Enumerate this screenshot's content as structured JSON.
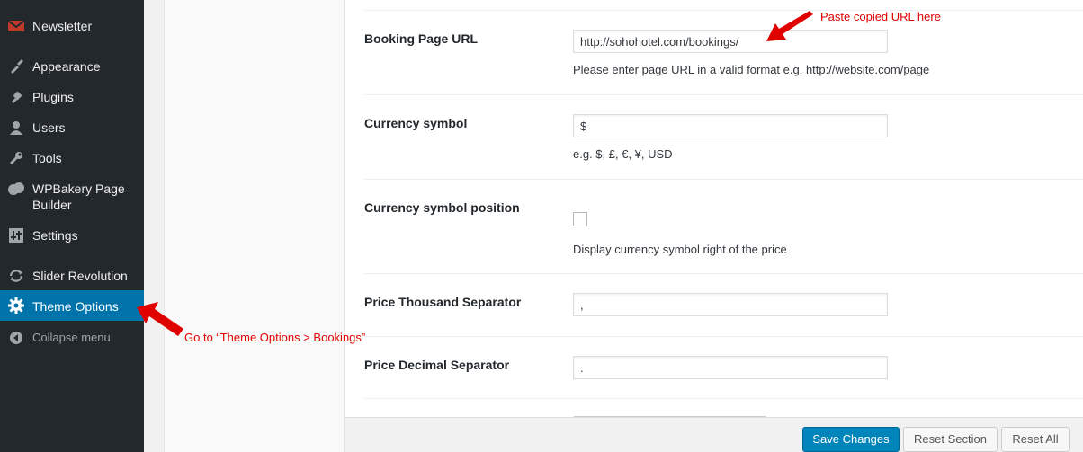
{
  "sidebar": {
    "items": [
      {
        "id": "newsletter",
        "label": "Newsletter",
        "icon": "envelope-icon"
      },
      {
        "id": "appearance",
        "label": "Appearance",
        "icon": "paintbrush-icon"
      },
      {
        "id": "plugins",
        "label": "Plugins",
        "icon": "plug-icon"
      },
      {
        "id": "users",
        "label": "Users",
        "icon": "user-icon"
      },
      {
        "id": "tools",
        "label": "Tools",
        "icon": "wrench-icon"
      },
      {
        "id": "wpbakery",
        "label": "WPBakery Page Builder",
        "icon": "bakery-icon"
      },
      {
        "id": "settings",
        "label": "Settings",
        "icon": "sliders-icon"
      },
      {
        "id": "slider",
        "label": "Slider Revolution",
        "icon": "refresh-icon"
      },
      {
        "id": "theme_options",
        "label": "Theme Options",
        "icon": "gear-icon"
      },
      {
        "id": "collapse",
        "label": "Collapse menu",
        "icon": "collapse-icon"
      }
    ]
  },
  "form": {
    "booking_url": {
      "label": "Booking Page URL",
      "value": "http://sohohotel.com/bookings/",
      "description": "Please enter page URL in a valid format e.g. http://website.com/page"
    },
    "currency_symbol": {
      "label": "Currency symbol",
      "value": "$",
      "description": "e.g. $, £, €, ¥, USD"
    },
    "currency_position": {
      "label": "Currency symbol position",
      "checked": false,
      "description": "Display currency symbol right of the price"
    },
    "thousand_sep": {
      "label": "Price Thousand Separator",
      "value": ","
    },
    "decimal_sep": {
      "label": "Price Decimal Separator",
      "value": "."
    }
  },
  "footer": {
    "save": "Save Changes",
    "reset_section": "Reset Section",
    "reset_all": "Reset All"
  },
  "annotations": {
    "paste_hint": "Paste copied URL here",
    "goto_hint": "Go to “Theme Options > Bookings”"
  },
  "colors": {
    "sidebar_bg": "#23282d",
    "active": "#0073aa",
    "primary_button": "#0085ba",
    "annotation": "#e00000"
  }
}
